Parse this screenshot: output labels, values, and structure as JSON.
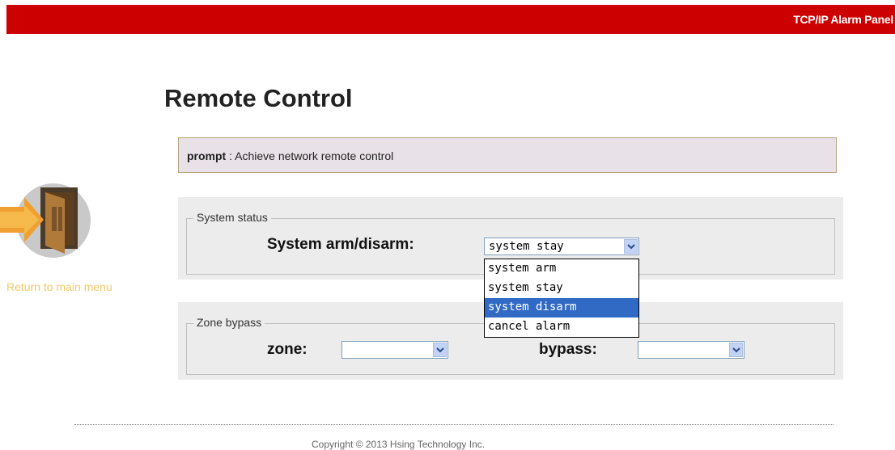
{
  "header": {
    "app_title": "TCP/IP Alarm Panel"
  },
  "sidebar": {
    "return_label": "Return to main menu"
  },
  "main": {
    "title": "Remote Control",
    "prompt": {
      "label": "prompt",
      "separator": " : ",
      "text": "Achieve network remote control"
    },
    "system_status": {
      "legend": "System status",
      "arm_label": "System arm/disarm:",
      "selected": "system stay",
      "options": [
        "system arm",
        "system stay",
        "system disarm",
        "cancel alarm"
      ],
      "highlighted_index": 2
    },
    "zone_bypass": {
      "legend": "Zone bypass",
      "zone_label": "zone:",
      "zone_value": "",
      "bypass_label": "bypass:",
      "bypass_value": ""
    }
  },
  "footer": {
    "copyright": "Copyright © 2013 Hsing Technology Inc."
  },
  "colors": {
    "header_bg": "#cc0000",
    "link": "#f2c96a",
    "highlight": "#316ac5"
  }
}
